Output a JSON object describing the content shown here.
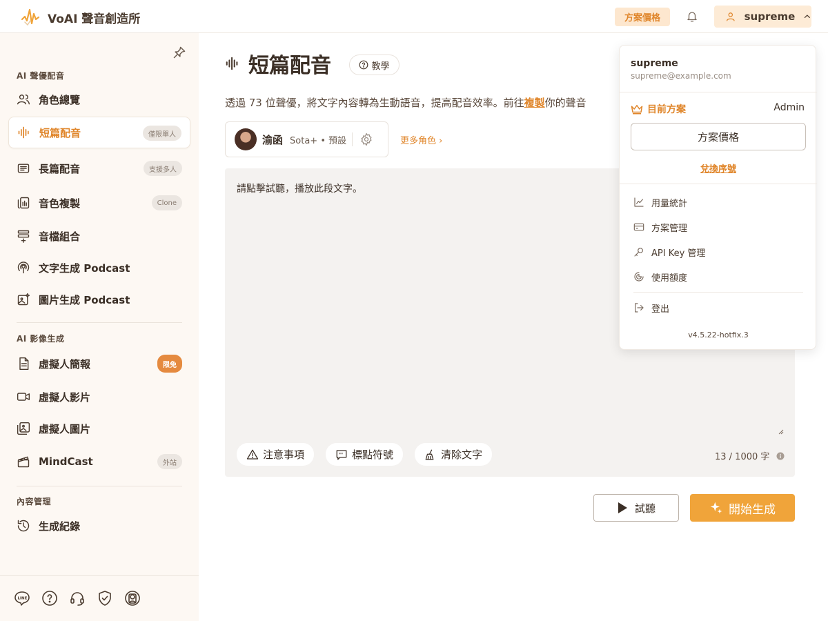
{
  "header": {
    "brand": "VoAI 聲音創造所",
    "pricing_label": "方案價格",
    "username": "supreme"
  },
  "sidebar": {
    "sections": [
      {
        "label": "AI 聲優配音"
      },
      {
        "label": "AI 影像生成"
      },
      {
        "label": "內容管理"
      }
    ],
    "items": [
      {
        "label": "角色總覽",
        "icon": "users-icon"
      },
      {
        "label": "短篇配音",
        "icon": "waveform-icon",
        "badge": "僅限單人",
        "active": true
      },
      {
        "label": "長篇配音",
        "icon": "list-doc-icon",
        "badge": "支援多人"
      },
      {
        "label": "音色複製",
        "icon": "clone-voice-icon",
        "badge": "Clone"
      },
      {
        "label": "音檔組合",
        "icon": "stack-add-icon"
      },
      {
        "label": "文字生成 Podcast",
        "icon": "podcast-icon"
      },
      {
        "label": "圖片生成 Podcast",
        "icon": "image-sparkle-icon"
      },
      {
        "label": "虛擬人簡報",
        "icon": "document-icon",
        "badge": "限免"
      },
      {
        "label": "虛擬人影片",
        "icon": "video-icon"
      },
      {
        "label": "虛擬人圖片",
        "icon": "image-icon"
      },
      {
        "label": "MindCast",
        "icon": "clapper-icon",
        "badge": "外站"
      },
      {
        "label": "生成紀錄",
        "icon": "history-icon"
      }
    ],
    "footer_icons": [
      "line-icon",
      "help-icon",
      "support-headset-icon",
      "shield-icon",
      "account-icon"
    ]
  },
  "main": {
    "title": "短篇配音",
    "tutorial_label": "教學",
    "description_before": "透過 73 位聲優，將文字內容轉為生動語音，提高配音效率。前往",
    "description_link": "複製",
    "description_after": "你的聲音",
    "voice": {
      "name": "渝函",
      "tier": "Sota+",
      "dot": "•",
      "tag": "預設"
    },
    "more_roles_label": "更多角色",
    "editor_text": "請點擊試聽，播放此段文字。",
    "tools": {
      "notes": "注意事項",
      "punctuation": "標點符號",
      "clear": "清除文字"
    },
    "counter": "13 / 1000 字",
    "listen_label": "試聽",
    "generate_label": "開始生成"
  },
  "dropdown": {
    "name": "supreme",
    "email": "supreme@example.com",
    "plan_label": "目前方案",
    "role": "Admin",
    "pricing_button": "方案價格",
    "redeem_label": "兌換序號",
    "menu": [
      {
        "label": "用量統計",
        "icon": "chart-icon"
      },
      {
        "label": "方案管理",
        "icon": "card-icon"
      },
      {
        "label": "API Key 管理",
        "icon": "key-icon"
      },
      {
        "label": "使用額度",
        "icon": "quota-icon"
      }
    ],
    "logout_label": "登出",
    "version": "v4.5.22-hotfix.3"
  },
  "colors": {
    "accent": "#e0862b",
    "accent_button": "#f0a43a",
    "sidebar_bg": "#fdf8f3",
    "editor_bg": "#f4f2f0"
  }
}
